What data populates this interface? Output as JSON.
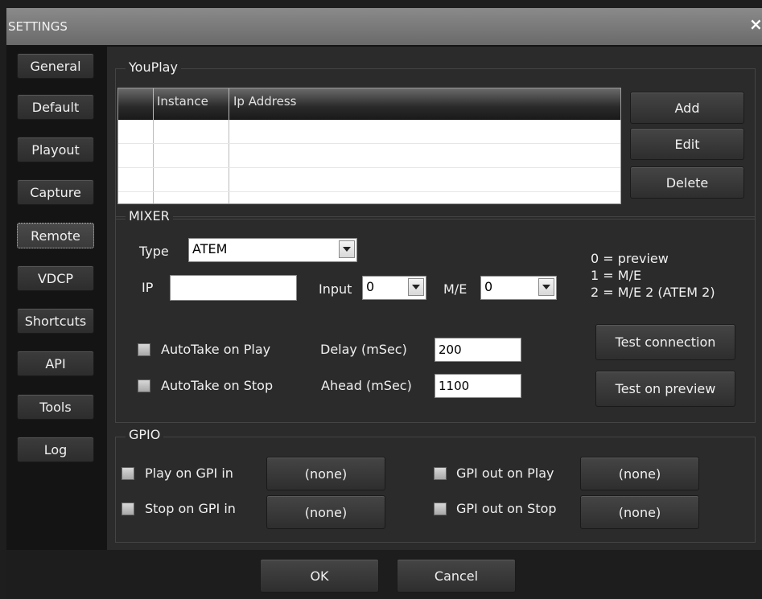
{
  "window": {
    "title": "SETTINGS",
    "close_label": "×"
  },
  "sidebar": {
    "items": [
      {
        "label": "General"
      },
      {
        "label": "Default"
      },
      {
        "label": "Playout"
      },
      {
        "label": "Capture"
      },
      {
        "label": "Remote",
        "active": true
      },
      {
        "label": "VDCP"
      },
      {
        "label": "Shortcuts"
      },
      {
        "label": "API"
      },
      {
        "label": "Tools"
      },
      {
        "label": "Log"
      }
    ]
  },
  "youplay": {
    "group_label": "YouPlay",
    "table": {
      "columns": [
        "",
        "Instance",
        "Ip Address"
      ],
      "rows": []
    },
    "buttons": {
      "add": "Add",
      "edit": "Edit",
      "delete": "Delete"
    }
  },
  "mixer": {
    "group_label": "MIXER",
    "type_label": "Type",
    "type_value": "ATEM",
    "ip_label": "IP",
    "ip_value": "",
    "input_label": "Input",
    "input_value": "0",
    "me_label": "M/E",
    "me_value": "0",
    "info_lines": [
      "0 = preview",
      "1 = M/E",
      "2 = M/E 2 (ATEM 2)"
    ],
    "autotake_play_label": "AutoTake on Play",
    "autotake_stop_label": "AutoTake on Stop",
    "delay_label": "Delay (mSec)",
    "delay_value": "200",
    "ahead_label": "Ahead (mSec)",
    "ahead_value": "1100",
    "test_connection": "Test connection",
    "test_preview": "Test on preview"
  },
  "gpio": {
    "group_label": "GPIO",
    "play_on_gpi": "Play on GPI in",
    "stop_on_gpi": "Stop on GPI in",
    "gpi_out_play": "GPI out on Play",
    "gpi_out_stop": "GPI out on Stop",
    "play_on_gpi_value": "(none)",
    "stop_on_gpi_value": "(none)",
    "gpi_out_play_value": "(none)",
    "gpi_out_stop_value": "(none)"
  },
  "footer": {
    "ok": "OK",
    "cancel": "Cancel"
  }
}
